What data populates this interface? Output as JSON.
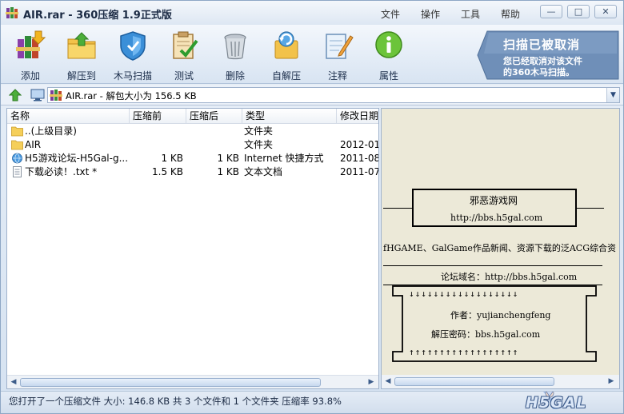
{
  "window": {
    "title": "AIR.rar - 360压缩 1.9正式版",
    "menu": [
      "文件",
      "操作",
      "工具",
      "帮助"
    ],
    "controls": {
      "minimize": "—",
      "maximize": "□",
      "close": "✕"
    }
  },
  "toolbar": {
    "buttons": [
      {
        "label": "添加",
        "icon": "books-add-icon"
      },
      {
        "label": "解压到",
        "icon": "folder-extract-icon"
      },
      {
        "label": "木马扫描",
        "icon": "shield-icon"
      },
      {
        "label": "测试",
        "icon": "clipboard-check-icon"
      },
      {
        "label": "删除",
        "icon": "trash-icon"
      },
      {
        "label": "自解压",
        "icon": "self-extract-icon"
      },
      {
        "label": "注释",
        "icon": "note-pen-icon"
      },
      {
        "label": "属性",
        "icon": "info-icon"
      }
    ],
    "notice": {
      "title": "扫描已被取消",
      "line1": "您已经取消对该文件",
      "line2": "的360木马扫描。"
    }
  },
  "address": {
    "path": "AIR.rar - 解包大小为 156.5 KB",
    "dropdown": "▼"
  },
  "filelist": {
    "columns": [
      "名称",
      "压缩前",
      "压缩后",
      "类型",
      "修改日期"
    ],
    "rows": [
      {
        "name": "..(上级目录)",
        "before": "",
        "after": "",
        "type": "文件夹",
        "date": "",
        "icon": "folder-icon"
      },
      {
        "name": "AIR",
        "before": "",
        "after": "",
        "type": "文件夹",
        "date": "2012-01-",
        "icon": "folder-icon"
      },
      {
        "name": "H5游戏论坛-H5Gal-g...",
        "before": "1 KB",
        "after": "1 KB",
        "type": "Internet 快捷方式",
        "date": "2011-08-",
        "icon": "internet-shortcut-icon"
      },
      {
        "name": "下载必读！.txt *",
        "before": "1.5 KB",
        "after": "1 KB",
        "type": "文本文档",
        "date": "2011-07-",
        "icon": "text-file-icon"
      }
    ]
  },
  "preview": {
    "site_name": "邪恶游戏网",
    "site_url": "http://bbs.h5gal.com",
    "description": "fHGAME、GalGame作品新闻、资源下载的泛ACG综合资",
    "forum_domain": "论坛域名：http://bbs.h5gal.com",
    "down_arrows": "↓↓↓↓↓↓↓↓↓↓↓↓↓↓↓↓↓↓",
    "author": "作者：yujianchengfeng",
    "password": "解压密码：bbs.h5gal.com",
    "up_arrows": "↑↑↑↑↑↑↑↑↑↑↑↑↑↑↑↑↑↑"
  },
  "status": {
    "text": "您打开了一个压缩文件 大小: 146.8 KB 共 3 个文件和 1 个文件夹 压缩率 93.8%",
    "logo": "H5GAL"
  },
  "colors": {
    "accent": "#3f6fb0",
    "notice": "#6f8fb8",
    "frame": "#8ea7c5"
  }
}
